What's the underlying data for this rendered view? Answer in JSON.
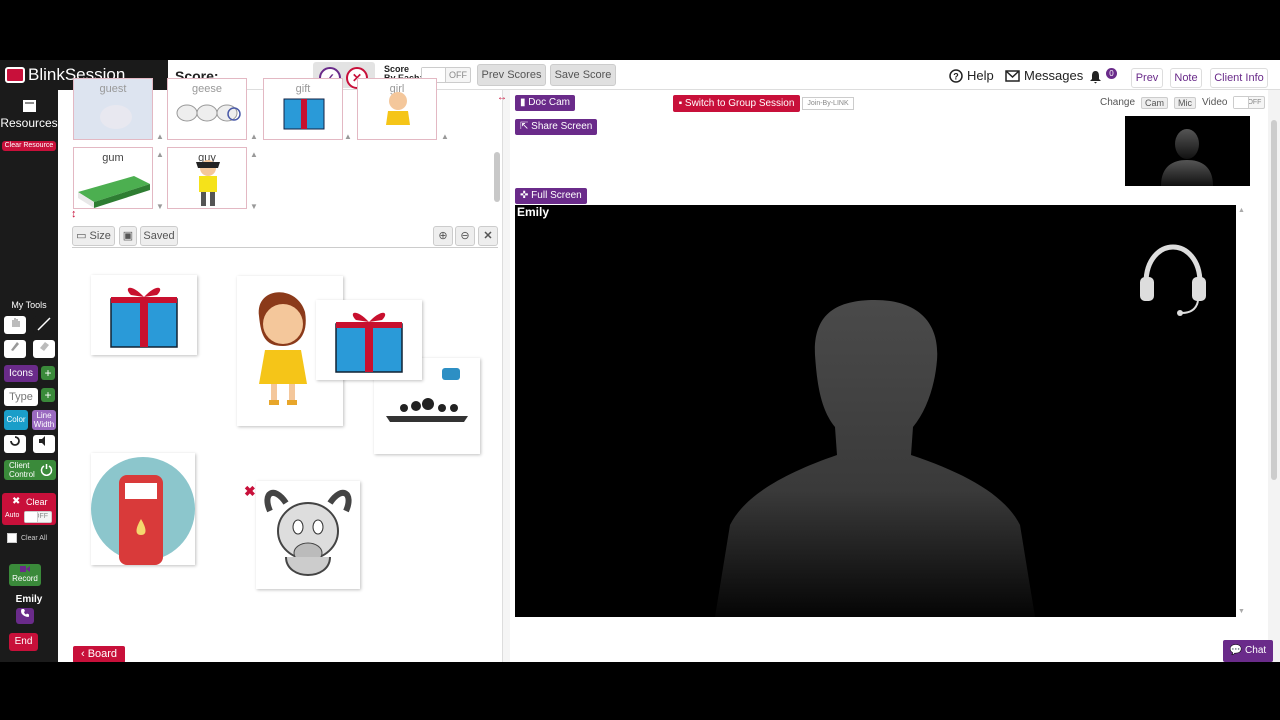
{
  "app": {
    "logo_text": "BlinkSession",
    "accent_purple": "#6a2b8a",
    "accent_red": "#c8103a"
  },
  "topbar": {
    "score_label": "Score:",
    "score_by_each_line1": "Score",
    "score_by_each_line2": "By Each:",
    "score_toggle": "OFF",
    "prev_scores": "Prev Scores",
    "save_score": "Save Score",
    "help": "Help",
    "messages": "Messages",
    "notification_count": "0",
    "prev": "Prev",
    "note": "Note",
    "client_info": "Client Info"
  },
  "sidebar": {
    "resources": "Resources",
    "clear_resource": "Clear Resource",
    "my_tools": "My Tools",
    "icons": "Icons",
    "type": "Type",
    "color": "Color",
    "line_width_1": "Line",
    "line_width_2": "Width",
    "client_control_1": "Client",
    "client_control_2": "Control",
    "clear": "Clear",
    "auto": "Auto",
    "auto_toggle": "OFF",
    "clear_all": "Clear All",
    "record": "Record",
    "client_name": "Emily",
    "end": "End"
  },
  "resources": {
    "tiles": [
      {
        "label": "guest",
        "icon": "guest-icon"
      },
      {
        "label": "geese",
        "icon": "geese-icon"
      },
      {
        "label": "gift",
        "icon": "gift-icon"
      },
      {
        "label": "girl",
        "icon": "girl-icon"
      },
      {
        "label": "gum",
        "icon": "gum-icon"
      },
      {
        "label": "guy",
        "icon": "guy-icon"
      }
    ]
  },
  "board": {
    "size": "Size",
    "saved": "Saved",
    "board_button": "Board"
  },
  "video": {
    "doc_cam": "Doc Cam",
    "share_screen": "Share Screen",
    "full_screen": "Full Screen",
    "switch_group": "Switch to Group Session",
    "join_by_link": "Join-By-LINK",
    "change": "Change",
    "cam": "Cam",
    "mic": "Mic",
    "video_label": "Video",
    "video_toggle": "OFF",
    "participant_name": "Emily",
    "chat": "Chat"
  }
}
